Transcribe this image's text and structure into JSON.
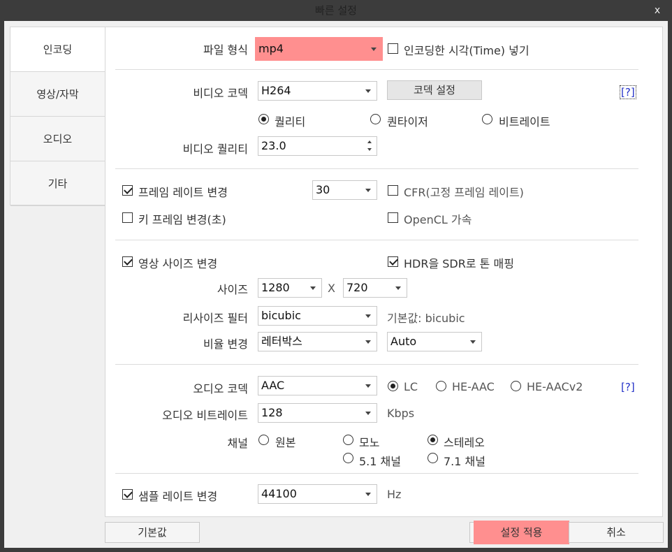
{
  "window": {
    "title": "빠른 설정",
    "close_label": "x"
  },
  "sidebar": {
    "items": [
      {
        "label": "인코딩"
      },
      {
        "label": "영상/자막"
      },
      {
        "label": "오디오"
      },
      {
        "label": "기타"
      }
    ]
  },
  "encoding": {
    "file_format_label": "파일 형식",
    "file_format_value": "mp4",
    "insert_time_label": "인코딩한 시각(Time) 넣기",
    "video_codec_label": "비디오 코덱",
    "video_codec_value": "H264",
    "codec_settings_label": "코덱 설정",
    "help_label": "[?]",
    "rate_modes": [
      "퀄리티",
      "퀀타이저",
      "비트레이트"
    ],
    "video_quality_label": "비디오 퀄리티",
    "video_quality_value": "23.0"
  },
  "frame": {
    "change_framerate_label": "프레임 레이트 변경",
    "framerate_value": "30",
    "cfr_label": "CFR(고정 프레임 레이트)",
    "keyframe_label": "키 프레임 변경(초)",
    "opencl_label": "OpenCL 가속"
  },
  "video_size": {
    "change_size_label": "영상 사이즈 변경",
    "hdr_label": "HDR을 SDR로 톤 매핑",
    "size_label": "사이즈",
    "width_value": "1280",
    "x_label": "X",
    "height_value": "720",
    "resize_filter_label": "리사이즈 필터",
    "resize_filter_value": "bicubic",
    "default_hint": "기본값: bicubic",
    "ratio_label": "비율 변경",
    "ratio_value": "레터박스",
    "ratio_auto_value": "Auto"
  },
  "audio": {
    "audio_codec_label": "오디오 코덱",
    "audio_codec_value": "AAC",
    "profiles": [
      "LC",
      "HE-AAC",
      "HE-AACv2"
    ],
    "help_label": "[?]",
    "bitrate_label": "오디오 비트레이트",
    "bitrate_value": "128",
    "bitrate_unit": "Kbps",
    "channel_label": "채널",
    "channels": [
      "원본",
      "모노",
      "스테레오",
      "5.1 채널",
      "7.1 채널"
    ],
    "samplerate_label": "샘플 레이트 변경",
    "samplerate_value": "44100",
    "samplerate_unit": "Hz"
  },
  "footer": {
    "default_label": "기본값",
    "apply_label": "설정 적용",
    "cancel_label": "취소"
  },
  "colors": {
    "highlight": "#ff8f8f",
    "help_link": "#2230c8",
    "titlebar": "#3c3c3c"
  }
}
